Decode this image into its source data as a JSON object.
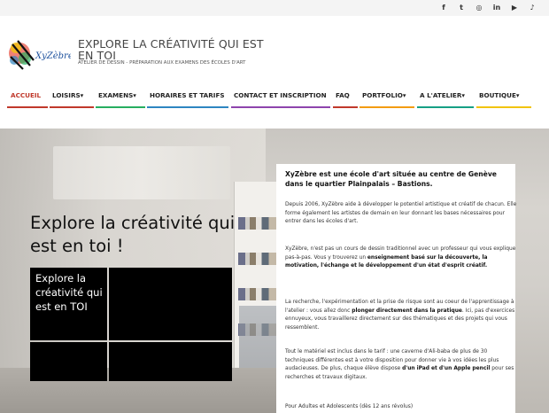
{
  "social": {
    "facebook": "f",
    "twitter": "t",
    "instagram": "◎",
    "linkedin": "in",
    "youtube": "▶",
    "tiktok": "♪"
  },
  "header": {
    "logo_text": "XyZèbre",
    "title": "EXPLORE LA CRÉATIVITÉ QUI EST EN TOI",
    "tagline": "ATELIER DE DESSIN - PRÉPARATION AUX EXAMENS DES ÉCOLES D'ART"
  },
  "nav": {
    "items": [
      {
        "label": "ACCUEIL",
        "color": "#c0392b"
      },
      {
        "label": "LOISIRS▾",
        "color": "#c0392b"
      },
      {
        "label": "EXAMENS▾",
        "color": "#27ae60"
      },
      {
        "label": "HORAIRES ET TARIFS",
        "color": "#2e86c1"
      },
      {
        "label": "CONTACT ET INSCRIPTION",
        "color": "#8e44ad"
      },
      {
        "label": "FAQ",
        "color": "#c0392b"
      },
      {
        "label": "PORTFOLIO▾",
        "color": "#f39c12"
      },
      {
        "label": "A L'ATELIER▾",
        "color": "#16a085"
      },
      {
        "label": "BOUTIQUE▾",
        "color": "#f1c40f"
      }
    ]
  },
  "hero": {
    "heading": "Explore la créativité qui est en toi !",
    "tile_text": "Explore la créativité qui est en TOI"
  },
  "panel": {
    "lead": "XyZèbre est une école d'art située au centre de Genève dans le quartier Plainpalais – Bastions.",
    "p1": "Depuis 2006, XyZèbre aide à développer le potentiel artistique et créatif de chacun. Elle forme également les artistes de demain en leur donnant les bases nécessaires pour entrer dans les écoles d'art.",
    "p2_a": "XyZèbre, n'est pas un cours de dessin traditionnel avec un professeur qui vous explique pas-à-pas. Vous y trouverez un ",
    "p2_b": "enseignement basé sur la découverte, la motivation, l'échange et le développement d'un état d'esprit créatif.",
    "p3_a": "La recherche, l'expérimentation et la prise de risque sont au coeur de l'apprentissage à l'atelier : vous allez donc ",
    "p3_b": "plonger directement dans la pratique",
    "p3_c": ". Ici, pas d'exercices ennuyeux, vous travaillerez directement sur des thématiques et des projets qui vous ressemblent.",
    "p4_a": "Tout le matériel est inclus dans le tarif : une caverne d'Ali-baba de plus de 30 techniques différentes est à votre disposition pour donner vie à vos idées les plus audacieuses. De plus, chaque élève dispose ",
    "p4_b": "d'un iPad et d'un Apple pencil",
    "p4_c": " pour ses recherches et travaux digitaux.",
    "p5": "Pour Adultes et Adolescents (dès 12 ans révolus)"
  }
}
